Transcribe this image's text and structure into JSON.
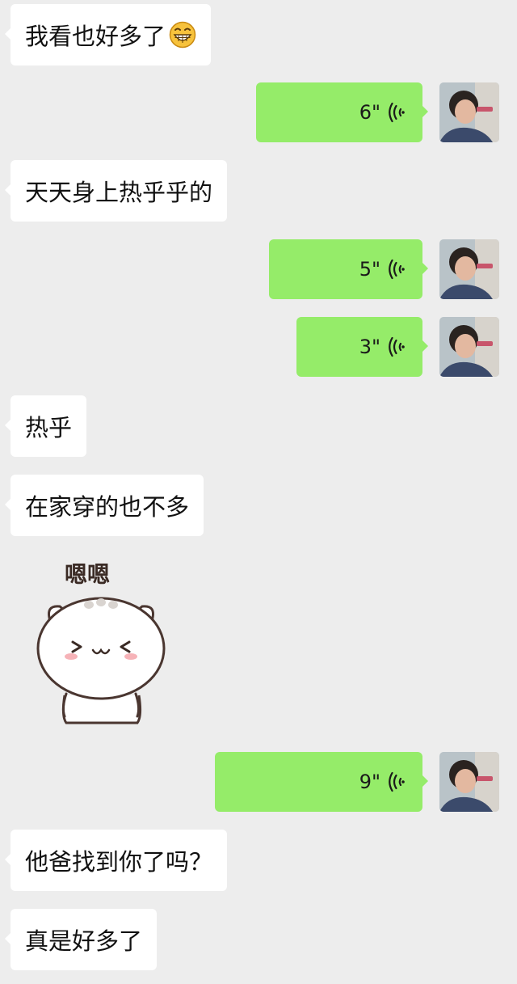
{
  "messages": [
    {
      "side": "in",
      "type": "text",
      "text": "我看也好多了",
      "emoji": "grinning-face-icon"
    },
    {
      "side": "out",
      "type": "voice",
      "duration": "6\""
    },
    {
      "side": "in",
      "type": "text",
      "text": "天天身上热乎乎的"
    },
    {
      "side": "out",
      "type": "voice",
      "duration": "5\""
    },
    {
      "side": "out",
      "type": "voice",
      "duration": "3\""
    },
    {
      "side": "in",
      "type": "text",
      "text": "热乎"
    },
    {
      "side": "in",
      "type": "text",
      "text": "在家穿的也不多"
    },
    {
      "side": "in",
      "type": "sticker",
      "caption": "嗯嗯",
      "sticker": "cat-sticker-icon"
    },
    {
      "side": "out",
      "type": "voice",
      "duration": "9\""
    },
    {
      "side": "in",
      "type": "text",
      "text": "他爸找到你了吗？"
    },
    {
      "side": "in",
      "type": "text",
      "text": "真是好多了"
    }
  ],
  "colors": {
    "background": "#ededed",
    "incoming_bubble": "#ffffff",
    "outgoing_bubble": "#95ec69",
    "text": "#111111"
  }
}
